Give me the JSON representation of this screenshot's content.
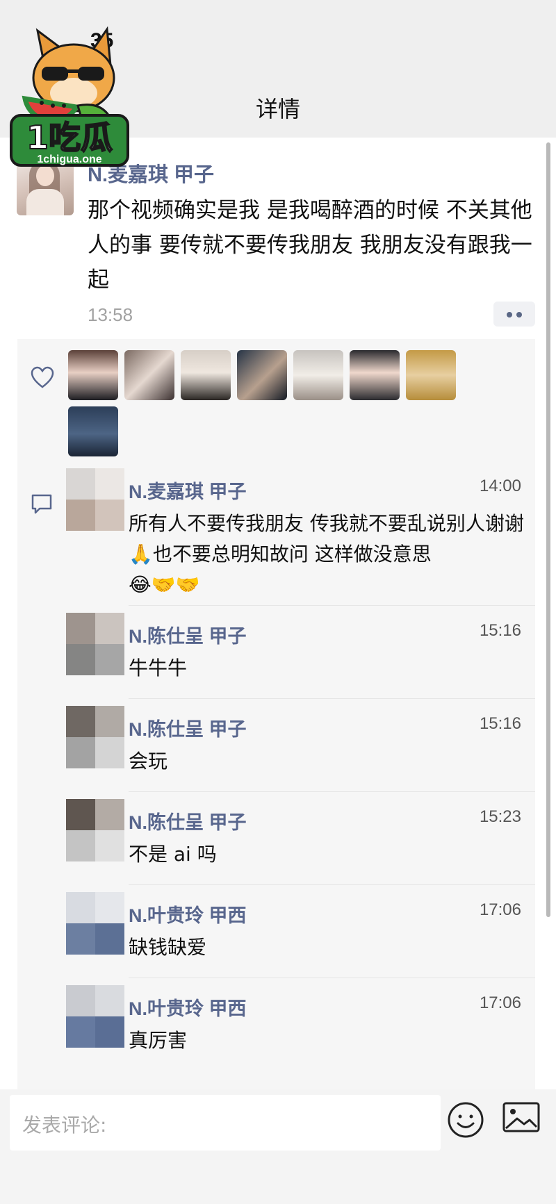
{
  "status_bar": {
    "time": "35"
  },
  "header": {
    "title": "详情"
  },
  "logo": {
    "text": "1吃瓜",
    "url": "1chigua.one"
  },
  "post": {
    "author": "N.麦嘉琪 甲子",
    "text": "那个视频确实是我 是我喝醉酒的时候 不关其他人的事 要传就不要传我朋友 我朋友没有跟我一起",
    "time": "13:58"
  },
  "likes": {
    "count": 8
  },
  "comments": [
    {
      "name": "N.麦嘉琪 甲子",
      "time": "14:00",
      "text": "所有人不要传我朋友 传我就不要乱说别人谢谢🙏也不要总明知故问 这样做没意思",
      "emojis": "😂🤝🤝"
    },
    {
      "name": "N.陈仕呈 甲子",
      "time": "15:16",
      "text": "牛牛牛"
    },
    {
      "name": "N.陈仕呈 甲子",
      "time": "15:16",
      "text": "会玩"
    },
    {
      "name": "N.陈仕呈 甲子",
      "time": "15:23",
      "text": "不是 ai 吗"
    },
    {
      "name": "N.叶贵玲 甲西",
      "time": "17:06",
      "text": "缺钱缺爱"
    },
    {
      "name": "N.叶贵玲 甲西",
      "time": "17:06",
      "text": "真厉害"
    }
  ],
  "input": {
    "placeholder": "发表评论:"
  },
  "colors": {
    "name_link": "#58668d",
    "panel_bg": "#f6f6f6",
    "time_gray": "#a2a2a2"
  }
}
